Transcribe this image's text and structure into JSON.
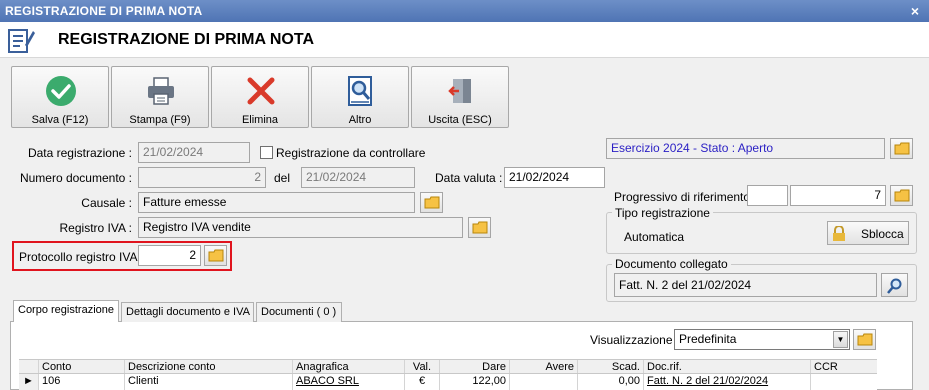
{
  "window": {
    "title": "REGISTRAZIONE DI PRIMA NOTA",
    "close_label": "×"
  },
  "header": {
    "title": "REGISTRAZIONE DI PRIMA NOTA"
  },
  "toolbar": {
    "save_label": "Salva (F12)",
    "print_label": "Stampa (F9)",
    "delete_label": "Elimina",
    "other_label": "Altro",
    "exit_label": "Uscita (ESC)"
  },
  "form": {
    "data_registrazione_label": "Data registrazione :",
    "data_registrazione_value": "21/02/2024",
    "registrazione_da_controllare_label": "Registrazione da controllare",
    "numero_documento_label": "Numero documento :",
    "numero_documento_value": "2",
    "del_label": "del",
    "del_value": "21/02/2024",
    "data_valuta_label": "Data valuta :",
    "data_valuta_value": "21/02/2024",
    "causale_label": "Causale :",
    "causale_value": "Fatture emesse",
    "registro_iva_label": "Registro IVA :",
    "registro_iva_value": "Registro IVA vendite",
    "protocollo_label": "Protocollo registro IVA :",
    "protocollo_value": "2"
  },
  "right_panel": {
    "esercizio_value": "Esercizio 2024 - Stato : Aperto",
    "progressivo_label": "Progressivo di riferimento :",
    "progressivo_value_1": "",
    "progressivo_value_2": "7",
    "tipo_registrazione_title": "Tipo registrazione",
    "tipo_registrazione_value": "Automatica",
    "sblocca_label": "Sblocca",
    "documento_collegato_title": "Documento collegato",
    "documento_collegato_value": "Fatt. N. 2 del 21/02/2024"
  },
  "tabs": [
    {
      "label": "Corpo registrazione"
    },
    {
      "label": "Dettagli documento e IVA"
    },
    {
      "label": "Documenti ( 0 )"
    }
  ],
  "view": {
    "label": "Visualizzazione :",
    "selected": "Predefinita"
  },
  "grid": {
    "headers": {
      "conto": "Conto",
      "descrizione": "Descrizione conto",
      "anagrafica": "Anagrafica",
      "val": "Val.",
      "dare": "Dare",
      "avere": "Avere",
      "scad": "Scad.",
      "docrif": "Doc.rif.",
      "ccr": "CCR"
    },
    "rows": [
      {
        "conto": "106",
        "descrizione": "Clienti",
        "anagrafica": "ABACO SRL",
        "val": "€",
        "dare": "122,00",
        "avere": "",
        "scad": "0,00",
        "docrif": "Fatt. N. 2 del 21/02/2024",
        "ccr": ""
      }
    ]
  },
  "colors": {
    "title_bar": "#5b7fbd",
    "highlight_border": "#e0141e",
    "esercizio_text": "#2a1fc4"
  }
}
